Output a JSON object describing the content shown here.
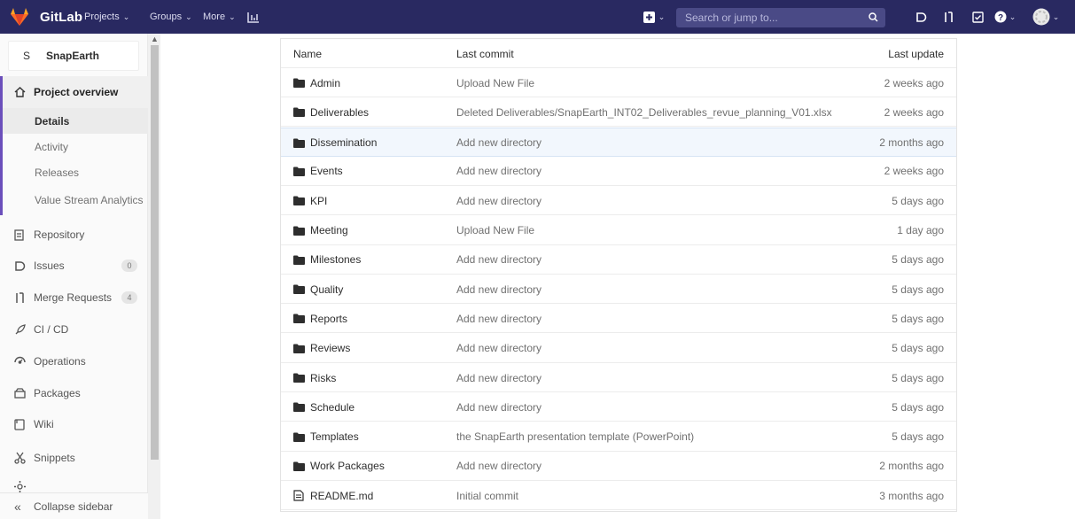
{
  "topbar": {
    "brand": "GitLab",
    "nav": [
      {
        "label": "Projects"
      },
      {
        "label": "Groups"
      },
      {
        "label": "More"
      }
    ],
    "search_placeholder": "Search or jump to...",
    "colors": {
      "bar": "#292961",
      "accent": "#fc6d26"
    }
  },
  "sidebar": {
    "project_avatar": "S",
    "project_name": "SnapEarth",
    "overview": {
      "label": "Project overview",
      "icon": "home-icon"
    },
    "overview_items": [
      {
        "label": "Details",
        "active": true
      },
      {
        "label": "Activity"
      },
      {
        "label": "Releases"
      },
      {
        "label": "Value Stream Analytics"
      }
    ],
    "items": [
      {
        "label": "Repository",
        "icon": "repository-icon"
      },
      {
        "label": "Issues",
        "icon": "issues-icon",
        "count": "0"
      },
      {
        "label": "Merge Requests",
        "icon": "merge-request-icon",
        "count": "4"
      },
      {
        "label": "CI / CD",
        "icon": "rocket-icon"
      },
      {
        "label": "Operations",
        "icon": "operations-icon"
      },
      {
        "label": "Packages",
        "icon": "package-icon"
      },
      {
        "label": "Wiki",
        "icon": "wiki-icon"
      },
      {
        "label": "Snippets",
        "icon": "scissors-icon"
      }
    ],
    "collapse_label": "Collapse sidebar"
  },
  "files": {
    "headers": {
      "name": "Name",
      "commit": "Last commit",
      "updated": "Last update"
    },
    "rows": [
      {
        "name": "Admin",
        "type": "folder",
        "commit": "Upload New File",
        "updated": "2 weeks ago"
      },
      {
        "name": "Deliverables",
        "type": "folder",
        "commit": "Deleted Deliverables/SnapEarth_INT02_Deliverables_revue_planning_V01.xlsx",
        "updated": "2 weeks ago"
      },
      {
        "name": "Dissemination",
        "type": "folder",
        "commit": "Add new directory",
        "updated": "2 months ago"
      },
      {
        "name": "Events",
        "type": "folder",
        "commit": "Add new directory",
        "updated": "2 weeks ago"
      },
      {
        "name": "KPI",
        "type": "folder",
        "commit": "Add new directory",
        "updated": "5 days ago"
      },
      {
        "name": "Meeting",
        "type": "folder",
        "commit": "Upload New File",
        "updated": "1 day ago"
      },
      {
        "name": "Milestones",
        "type": "folder",
        "commit": "Add new directory",
        "updated": "5 days ago"
      },
      {
        "name": "Quality",
        "type": "folder",
        "commit": "Add new directory",
        "updated": "5 days ago"
      },
      {
        "name": "Reports",
        "type": "folder",
        "commit": "Add new directory",
        "updated": "5 days ago"
      },
      {
        "name": "Reviews",
        "type": "folder",
        "commit": "Add new directory",
        "updated": "5 days ago"
      },
      {
        "name": "Risks",
        "type": "folder",
        "commit": "Add new directory",
        "updated": "5 days ago"
      },
      {
        "name": "Schedule",
        "type": "folder",
        "commit": "Add new directory",
        "updated": "5 days ago"
      },
      {
        "name": "Templates",
        "type": "folder",
        "commit": "the SnapEarth presentation template (PowerPoint)",
        "updated": "5 days ago"
      },
      {
        "name": "Work Packages",
        "type": "folder",
        "commit": "Add new directory",
        "updated": "2 months ago"
      },
      {
        "name": "README.md",
        "type": "file",
        "commit": "Initial commit",
        "updated": "3 months ago"
      }
    ]
  }
}
